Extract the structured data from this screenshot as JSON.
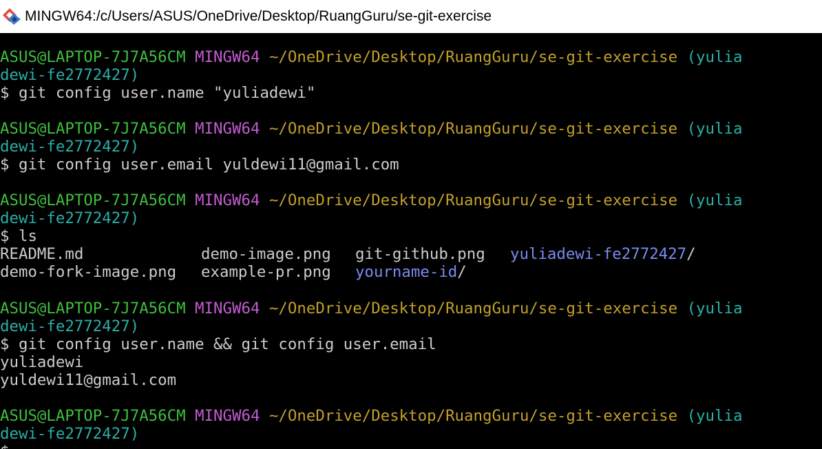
{
  "window": {
    "title": "MINGW64:/c/Users/ASUS/OneDrive/Desktop/RuangGuru/se-git-exercise",
    "icon": "git-bash-icon",
    "colors": {
      "background": "#000000",
      "user_host": "#3fbf3f",
      "msystem": "#c25bd0",
      "path": "#c2a02a",
      "branch": "#2ab0a8",
      "text": "#cccccc",
      "directory": "#7a8cf0"
    }
  },
  "prompt": {
    "user_host": "ASUS@LAPTOP-7J7A56CM",
    "msystem": "MINGW64",
    "path": "~/OneDrive/Desktop/RuangGuru/se-git-exercise",
    "branch_start": "(yulia",
    "branch_end": "dewi-fe2772427)",
    "symbol": "$"
  },
  "commands": {
    "cmd1": "git config user.name \"yuliadewi\"",
    "cmd2": "git config user.email yuldewi11@gmail.com",
    "cmd3": "ls",
    "cmd4": "git config user.name && git config user.email"
  },
  "ls_output": {
    "row1": [
      "README.md",
      "demo-image.png",
      "git-github.png",
      "yuliadewi-fe2772427"
    ],
    "row2": [
      "demo-fork-image.png",
      "example-pr.png",
      "yourname-id"
    ],
    "dir_suffix": "/"
  },
  "output": {
    "name": "yuliadewi",
    "email": "yuldewi11@gmail.com"
  }
}
